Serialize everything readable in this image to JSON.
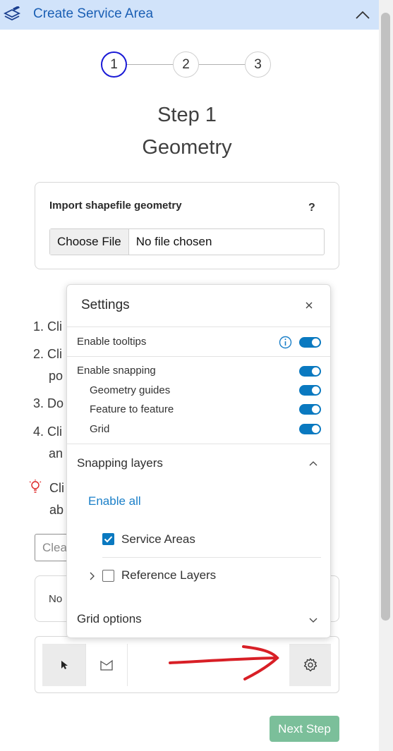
{
  "header": {
    "title": "Create Service Area",
    "app_icon": "layers-edit-icon",
    "collapse_icon": "chevron-up-icon",
    "accent": "#d1e3fa"
  },
  "stepper": {
    "steps": [
      "1",
      "2",
      "3"
    ],
    "active_step": 1
  },
  "step_heading": {
    "step": "Step 1",
    "name": "Geometry"
  },
  "import_card": {
    "label": "Import shapefile geometry",
    "help": "?",
    "choose_file": "Choose File",
    "file_status": "No file chosen"
  },
  "background_list": {
    "items": [
      "1. Cli",
      "2. Cli",
      "po",
      "3. Do",
      "4. Cli",
      "an"
    ],
    "tip_line1": "Cli",
    "tip_line2": "ab",
    "clear_partial": "Clea",
    "no_partial": "No"
  },
  "settings": {
    "title": "Settings",
    "enable_tooltips": "Enable tooltips",
    "enable_snapping": "Enable snapping",
    "geometry_guides": "Geometry guides",
    "feature_to_feature": "Feature to feature",
    "grid": "Grid",
    "toggles": {
      "enable_tooltips": true,
      "enable_snapping": true,
      "geometry_guides": true,
      "feature_to_feature": true,
      "grid": true
    },
    "snapping_layers": {
      "title": "Snapping layers",
      "enable_all": "Enable all",
      "layers": [
        {
          "label": "Service Areas",
          "checked": true
        },
        {
          "label": "Reference Layers",
          "checked": false
        }
      ]
    },
    "grid_options": "Grid options"
  },
  "footer": {
    "next_step": "Next Step",
    "next_color": "#7bbf9a"
  }
}
